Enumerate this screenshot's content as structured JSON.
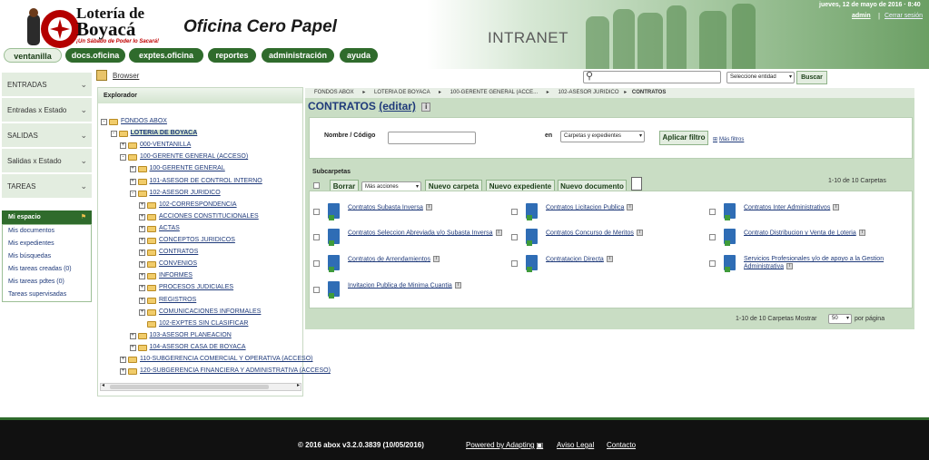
{
  "header": {
    "logo_line1": "Lotería de",
    "logo_line2": "Boyacá",
    "logo_tagline": "¡Un Sábado de Poder lo Sacará!",
    "app_title": "Oficina Cero Papel",
    "intranet_label": "INTRANET",
    "datetime": "jueves, 12 de mayo de 2016 · 8:40",
    "user": "admin",
    "separator": "|",
    "logout": "Cerrar sesión"
  },
  "nav": [
    "ventanilla",
    "docs.oficina",
    "exptes.oficina",
    "reportes",
    "administración",
    "ayuda"
  ],
  "sidebar": {
    "sections": [
      "ENTRADAS",
      "Entradas x Estado",
      "SALIDAS",
      "Salidas x Estado",
      "TAREAS"
    ],
    "my_space_title": "Mi espacio",
    "my_space_items": [
      "Mis documentos",
      "Mis expedientes",
      "Mis búsquedas",
      "Mis tareas creadas (0)",
      "Mis tareas pdtes (0)",
      "Tareas supervisadas"
    ]
  },
  "browser_link": "Browser",
  "explorer": {
    "title": "Explorador",
    "nodes": [
      {
        "label": "FONDOS ABOX",
        "depth": 0,
        "toggle": "-",
        "bold": false
      },
      {
        "label": "LOTERIA DE BOYACA",
        "depth": 1,
        "toggle": "-",
        "bold": true
      },
      {
        "label": "000-VENTANILLA",
        "depth": 2,
        "toggle": "+",
        "bold": false
      },
      {
        "label": "100-GERENTE GENERAL (ACCESO)",
        "depth": 2,
        "toggle": "-",
        "bold": false
      },
      {
        "label": "100-GERENTE GENERAL",
        "depth": 3,
        "toggle": "+",
        "bold": false
      },
      {
        "label": "101-ASESOR DE CONTROL INTERNO",
        "depth": 3,
        "toggle": "+",
        "bold": false
      },
      {
        "label": "102-ASESOR JURIDICO",
        "depth": 3,
        "toggle": "-",
        "bold": false
      },
      {
        "label": "102-CORRESPONDENCIA",
        "depth": 4,
        "toggle": "+",
        "bold": false
      },
      {
        "label": "ACCIONES CONSTITUCIONALES",
        "depth": 4,
        "toggle": "+",
        "bold": false
      },
      {
        "label": "ACTAS",
        "depth": 4,
        "toggle": "+",
        "bold": false
      },
      {
        "label": "CONCEPTOS JURIDICOS",
        "depth": 4,
        "toggle": "+",
        "bold": false
      },
      {
        "label": "CONTRATOS",
        "depth": 4,
        "toggle": "+",
        "bold": false
      },
      {
        "label": "CONVENIOS",
        "depth": 4,
        "toggle": "+",
        "bold": false
      },
      {
        "label": "INFORMES",
        "depth": 4,
        "toggle": "+",
        "bold": false
      },
      {
        "label": "PROCESOS JUDICIALES",
        "depth": 4,
        "toggle": "+",
        "bold": false
      },
      {
        "label": "REGISTROS",
        "depth": 4,
        "toggle": "+",
        "bold": false
      },
      {
        "label": "COMUNICACIONES INFORMALES",
        "depth": 4,
        "toggle": "+",
        "bold": false
      },
      {
        "label": "102-EXPTES SIN CLASIFICAR",
        "depth": 4,
        "toggle": "",
        "bold": false
      },
      {
        "label": "103-ASESOR PLANEACION",
        "depth": 3,
        "toggle": "+",
        "bold": false
      },
      {
        "label": "104-ASESOR CASA DE BOYACA",
        "depth": 3,
        "toggle": "+",
        "bold": false
      },
      {
        "label": "110-SUBGERENCIA COMERCIAL Y OPERATIVA (ACCESO)",
        "depth": 2,
        "toggle": "+",
        "bold": false
      },
      {
        "label": "120-SUBGERENCIA FINANCIERA Y ADMINISTRATIVA (ACCESO)",
        "depth": 2,
        "toggle": "+",
        "bold": false
      }
    ]
  },
  "search": {
    "select_value": "Seleccione entidad",
    "button": "Buscar"
  },
  "breadcrumb": [
    "FONDOS ABOX",
    "LOTERIA DE BOYACA",
    "100-GERENTE GENERAL (ACCE...",
    "102-ASESOR JURIDICO",
    "CONTRATOS"
  ],
  "main": {
    "title": "CONTRATOS",
    "edit": "(editar)",
    "filter_name_label": "Nombre / Código",
    "filter_in_label": "en",
    "filter_scope": "Carpetas y expedientes",
    "filter_button": "Aplicar filtro",
    "more_filters": "Más filtros",
    "subfolders_title": "Subcarpetas",
    "btn_delete": "Borrar",
    "more_actions": "Más acciones",
    "btn_new_folder": "Nuevo carpeta",
    "btn_new_file": "Nuevo expediente",
    "btn_new_doc": "Nuevo documento",
    "range_top": "1-10 de 10 Carpetas",
    "range_bottom": "1-10 de 10 Carpetas Mostrar",
    "page_size": "50",
    "per_page": "por página",
    "folders": [
      [
        "Contratos Subasta Inversa"
      ],
      [
        "Contratos Licitacion Publica"
      ],
      [
        "Contratos Inter Administrativos"
      ],
      [
        "Contratos Seleccion Abreviada y/o Subasta Inversa"
      ],
      [
        "Contratos Concurso de Meritos"
      ],
      [
        "Contrato Distribucion y Venta de Loteria"
      ],
      [
        "Contratos de Arrendamientos"
      ],
      [
        "Contratacion Directa"
      ],
      [
        "Servicios Profesionales y/o de apoyo a la Gestion",
        "Administrativa"
      ],
      [
        "Invitacion Publica de Minima Cuantia"
      ]
    ]
  },
  "footer": {
    "copyright": "© 2016 abox v3.2.0.3839 (10/05/2016)",
    "powered": "Powered by Adapting",
    "legal": "Aviso Legal",
    "contact": "Contacto"
  }
}
